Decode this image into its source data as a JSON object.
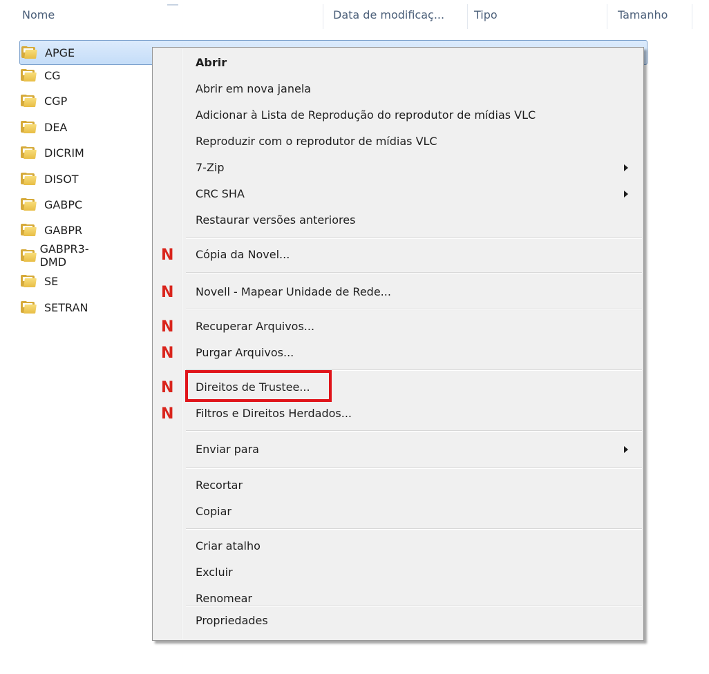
{
  "columns": {
    "name": "Nome",
    "modified": "Data de modificaç...",
    "type": "Tipo",
    "size": "Tamanho"
  },
  "files": [
    {
      "name": "APGE",
      "selected": true
    },
    {
      "name": "CG"
    },
    {
      "name": "CGP"
    },
    {
      "name": "DEA"
    },
    {
      "name": "DICRIM"
    },
    {
      "name": "DISOT"
    },
    {
      "name": "GABPC"
    },
    {
      "name": "GABPR"
    },
    {
      "name": "GABPR3-DMD"
    },
    {
      "name": "SE"
    },
    {
      "name": "SETRAN"
    }
  ],
  "menu": {
    "open": "Abrir",
    "open_new_window": "Abrir em nova janela",
    "vlc_add_playlist": "Adicionar à Lista de Reprodução do reprodutor de mídias VLC",
    "vlc_play": "Reproduzir com o reprodutor de mídias VLC",
    "zip": "7-Zip",
    "crc_sha": "CRC SHA",
    "restore_versions": "Restaurar versões anteriores",
    "novell_copy": "Cópia da Novel...",
    "novell_map_drive": "Novell - Mapear Unidade de Rede...",
    "recover_files": "Recuperar Arquivos...",
    "purge_files": "Purgar Arquivos...",
    "trustee_rights": "Direitos de Trustee...",
    "inherited_rights": "Filtros e Direitos Herdados...",
    "send_to": "Enviar para",
    "cut": "Recortar",
    "copy": "Copiar",
    "create_shortcut": "Criar atalho",
    "delete": "Excluir",
    "rename": "Renomear",
    "properties": "Propriedades",
    "novell_icon_glyph": "N"
  },
  "colors": {
    "highlight_box": "#e0141a",
    "novell_icon": "#d9241c",
    "selection": "#c5ddf8"
  }
}
